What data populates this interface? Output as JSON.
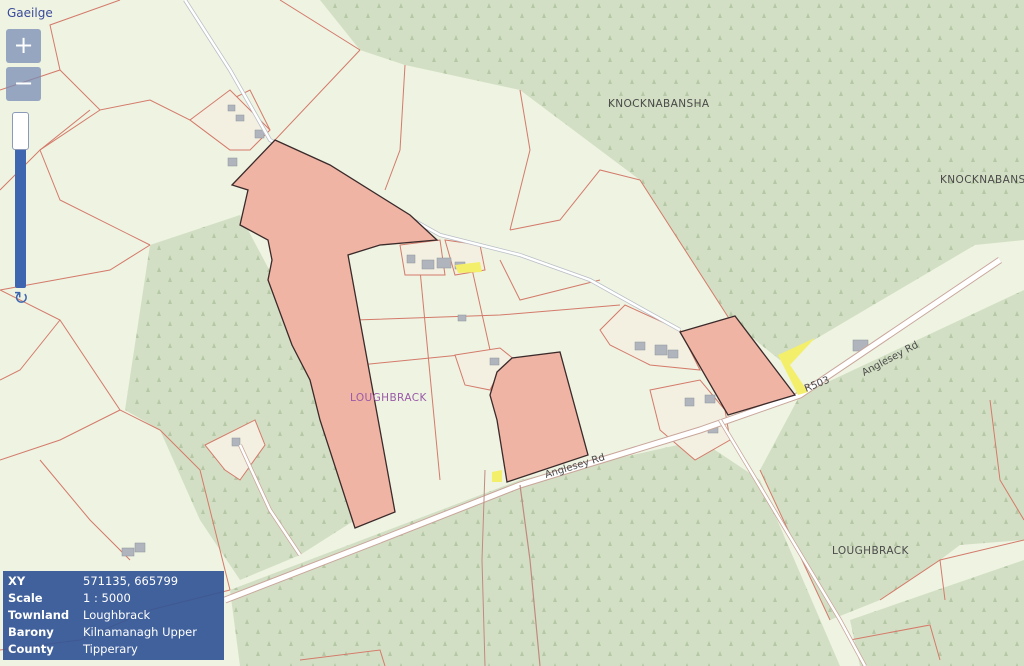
{
  "header": {
    "language_link": "Gaeilge"
  },
  "zoom": {
    "in_label": "+",
    "out_label": "−",
    "refresh_icon": "refresh-icon"
  },
  "labels": {
    "knocknabansha_1": "KNOCKNABANSHA",
    "knocknabansha_2": "KNOCKNABANSHA",
    "loughbrack_1": "LOUGHBRACK",
    "loughbrack_2": "LOUGHBRACK",
    "anglesey_rd_1": "Anglesey Rd",
    "anglesey_rd_2": "Anglesey Rd",
    "r503": "R503"
  },
  "info": {
    "rows": [
      {
        "key": "XY",
        "value": "571135, 665799"
      },
      {
        "key": "Scale",
        "value": "1 : 5000"
      },
      {
        "key": "Townland",
        "value": "Loughbrack"
      },
      {
        "key": "Barony",
        "value": "Kilnamanagh Upper"
      },
      {
        "key": "County",
        "value": "Tipperary"
      }
    ]
  },
  "colors": {
    "field": "#eef3e2",
    "forest": "#d3dfc4",
    "boundary": "#d47a6a",
    "parcel_fill": "#f0b4a4",
    "road": "#ffffff",
    "accent": "#3d65b0"
  }
}
